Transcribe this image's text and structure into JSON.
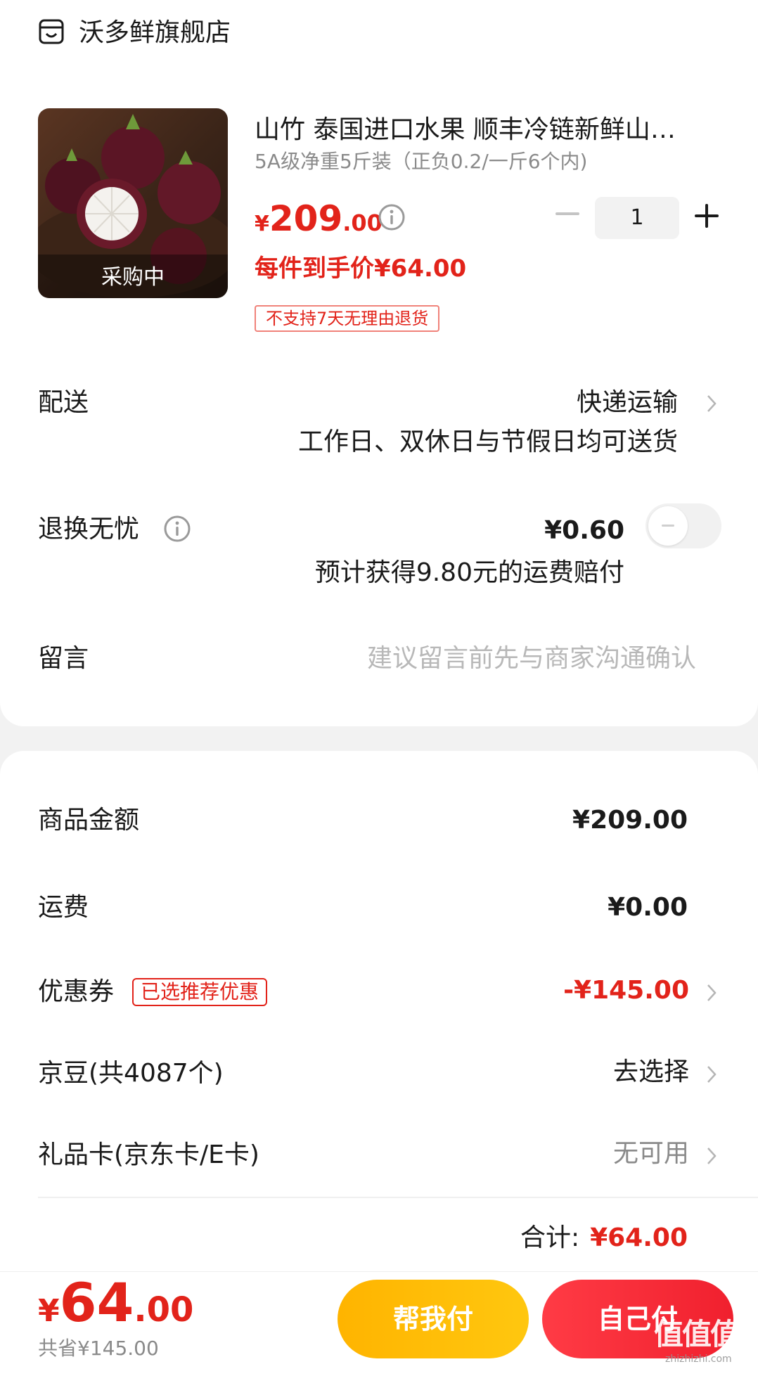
{
  "store": {
    "name": "沃多鲜旗舰店",
    "icon": "store-icon"
  },
  "product": {
    "title": "山竹 泰国进口水果 顺丰冷链新鲜山…",
    "spec": "5A级净重5斤装（正负0.2/一斤6个内)",
    "price_currency": "¥",
    "price_int": "209",
    "price_dec": ".00",
    "thumb_status": "采购中",
    "unit_price": "每件到手价¥64.00",
    "return_tag": "不支持7天无理由退货",
    "quantity": "1"
  },
  "delivery": {
    "label": "配送",
    "value": "快递运输",
    "note": "工作日、双休日与节假日均可送货"
  },
  "return_insurance": {
    "label": "退换无忧",
    "price": "¥0.60",
    "note": "预计获得9.80元的运费赔付",
    "enabled": false
  },
  "message": {
    "label": "留言",
    "placeholder": "建议留言前先与商家沟通确认"
  },
  "summary": {
    "goods_label": "商品金额",
    "goods_value": "¥209.00",
    "shipping_label": "运费",
    "shipping_value": "¥0.00",
    "coupon_label": "优惠券",
    "coupon_tag": "已选推荐优惠",
    "coupon_value": "-¥145.00",
    "beans_label": "京豆(共4087个)",
    "beans_value": "去选择",
    "giftcard_label": "礼品卡(京东卡/E卡)",
    "giftcard_value": "无可用",
    "total_label": "合计:",
    "total_value": "¥64.00"
  },
  "footer": {
    "currency": "¥",
    "price_int": "64",
    "price_dec": ".00",
    "saved": "共省¥145.00",
    "help_pay": "帮我付",
    "self_pay": "自己付"
  },
  "watermark": {
    "text": "值值值",
    "sub": "zhizhizhi.com"
  },
  "colors": {
    "accent": "#e2231a",
    "help_btn": "#ffb400",
    "self_btn": "#f0202e"
  }
}
